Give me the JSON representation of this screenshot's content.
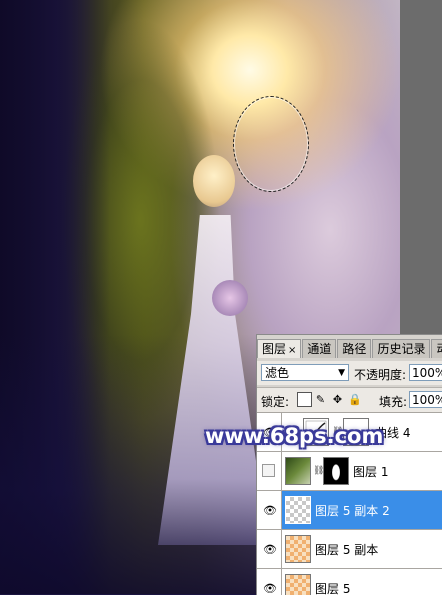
{
  "watermark": "www.68ps.com",
  "layers_panel": {
    "tabs": [
      {
        "label": "图层",
        "close": "×",
        "active": true
      },
      {
        "label": "通道",
        "active": false
      },
      {
        "label": "路径",
        "active": false
      },
      {
        "label": "历史记录",
        "active": false
      },
      {
        "label": "动",
        "active": false
      }
    ],
    "blend_mode": "滤色",
    "opacity_label": "不透明度:",
    "opacity_value": "100%",
    "lock_label": "锁定:",
    "fill_label": "填充:",
    "fill_value": "100%",
    "layers": [
      {
        "name": "曲线 4",
        "visible": true,
        "selected": false,
        "thumb": "curves-adjustment-icon",
        "mask": true
      },
      {
        "name": "图层 1",
        "visible": false,
        "selected": false,
        "thumb": "photo",
        "mask": true
      },
      {
        "name": "图层 5 副本 2",
        "visible": true,
        "selected": true,
        "thumb": "transparent"
      },
      {
        "name": "图层 5 副本",
        "visible": true,
        "selected": false,
        "thumb": "transparent-orange"
      },
      {
        "name": "图层 5",
        "visible": true,
        "selected": false,
        "thumb": "transparent-orange"
      }
    ]
  },
  "colors": {
    "selection_highlight": "#3a8ee8",
    "panel_bg": "#d6d3ce",
    "watermark_outline": "#3a3a9a"
  }
}
